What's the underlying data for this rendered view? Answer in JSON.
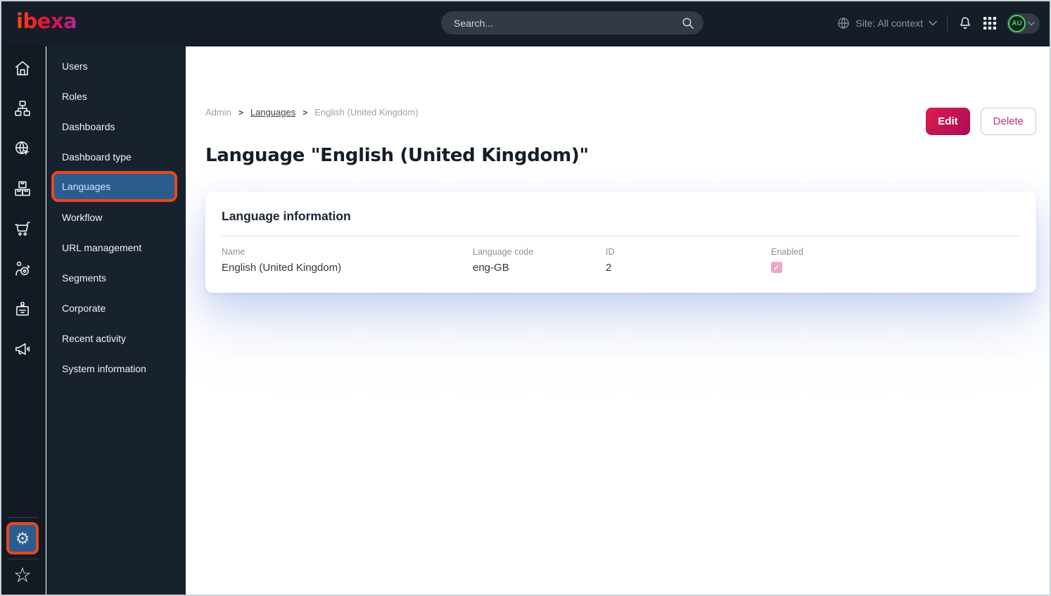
{
  "topbar": {
    "logo": "ibexa",
    "search": {
      "placeholder": "Search..."
    },
    "site_context": {
      "label": "Site: All context"
    },
    "user": {
      "initials": "AU"
    }
  },
  "sidebar": {
    "items": [
      {
        "label": "Users",
        "active": false
      },
      {
        "label": "Roles",
        "active": false
      },
      {
        "label": "Dashboards",
        "active": false
      },
      {
        "label": "Dashboard type",
        "active": false
      },
      {
        "label": "Languages",
        "active": true
      },
      {
        "label": "Workflow",
        "active": false
      },
      {
        "label": "URL management",
        "active": false
      },
      {
        "label": "Segments",
        "active": false
      },
      {
        "label": "Corporate",
        "active": false
      },
      {
        "label": "Recent activity",
        "active": false
      },
      {
        "label": "System information",
        "active": false
      }
    ]
  },
  "content": {
    "breadcrumb": {
      "items": [
        "Admin",
        "Languages",
        "English (United Kingdom)"
      ],
      "separator": ">"
    },
    "actions": {
      "edit": "Edit",
      "delete": "Delete"
    },
    "title": "Language \"English (United Kingdom)\"",
    "card": {
      "title": "Language information",
      "fields": [
        {
          "label": "Name",
          "value": "English (United Kingdom)"
        },
        {
          "label": "Language code",
          "value": "eng-GB"
        },
        {
          "label": "ID",
          "value": "2"
        },
        {
          "label": "Enabled",
          "checked": true,
          "glyph": "✓"
        }
      ]
    }
  },
  "icons": {
    "rail": [
      "home",
      "sitemap",
      "globe-cursor",
      "packages",
      "cart",
      "audience-target",
      "id-badge",
      "megaphone"
    ],
    "rail_bottom": [
      "settings-gear",
      "star"
    ],
    "gear_glyph": "⚙",
    "star_glyph": "☆"
  },
  "colors": {
    "topbar_bg": "#141d28",
    "rail_bg": "#121a24",
    "menu_bg": "#18222e",
    "selected_blue": "#2b5c8f",
    "annotation_orange": "#e8481d",
    "accent_gradient_start": "#dd1d4f",
    "accent_gradient_end": "#a80c58",
    "avatar_green": "#49d06c",
    "checkbox_pink": "#eda9c7"
  }
}
